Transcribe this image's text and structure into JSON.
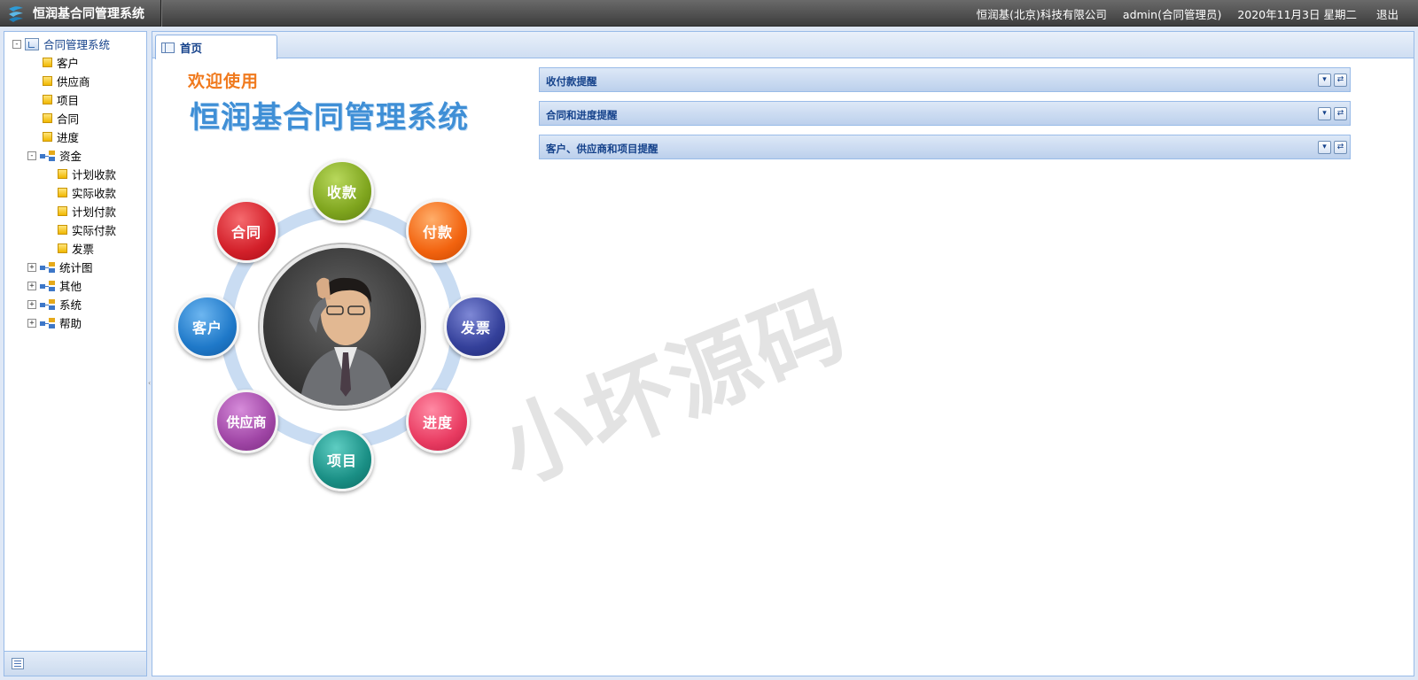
{
  "header": {
    "app_title": "恒润基合同管理系统",
    "company": "恒润基(北京)科技有限公司",
    "user": "admin(合同管理员)",
    "date": "2020年11月3日 星期二",
    "logout": "退出"
  },
  "tree": {
    "root": {
      "label": "合同管理系统",
      "toggle": "-"
    },
    "items": [
      {
        "label": "客户"
      },
      {
        "label": "供应商"
      },
      {
        "label": "项目"
      },
      {
        "label": "合同"
      },
      {
        "label": "进度"
      }
    ],
    "funds": {
      "label": "资金",
      "toggle": "-",
      "children": [
        {
          "label": "计划收款"
        },
        {
          "label": "实际收款"
        },
        {
          "label": "计划付款"
        },
        {
          "label": "实际付款"
        },
        {
          "label": "发票"
        }
      ]
    },
    "groups": [
      {
        "label": "统计图",
        "toggle": "+"
      },
      {
        "label": "其他",
        "toggle": "+"
      },
      {
        "label": "系统",
        "toggle": "+"
      },
      {
        "label": "帮助",
        "toggle": "+"
      }
    ]
  },
  "tabs": [
    {
      "label": "首页"
    }
  ],
  "home": {
    "welcome": "欢迎使用",
    "system_title": "恒润基合同管理系统",
    "bubbles": {
      "receipt": {
        "label": "收款",
        "color": "#7fa51e"
      },
      "payment": {
        "label": "付款",
        "color": "#f2630f"
      },
      "invoice": {
        "label": "发票",
        "color": "#34409a"
      },
      "progress": {
        "label": "进度",
        "color": "#e93c62"
      },
      "project": {
        "label": "项目",
        "color": "#1a8f85"
      },
      "supplier": {
        "label": "供应商",
        "color": "#a046a6"
      },
      "customer": {
        "label": "客户",
        "color": "#1f79c9"
      },
      "contract": {
        "label": "合同",
        "color": "#d3202a"
      }
    }
  },
  "reminders": [
    {
      "title": "收付款提醒"
    },
    {
      "title": "合同和进度提醒"
    },
    {
      "title": "客户、供应商和项目提醒"
    }
  ],
  "tool_icons": {
    "collapse": "▾",
    "refresh": "⇄"
  },
  "watermark": "小坏源码",
  "theme": {
    "accent": "#15428b",
    "border": "#99bbe8"
  }
}
